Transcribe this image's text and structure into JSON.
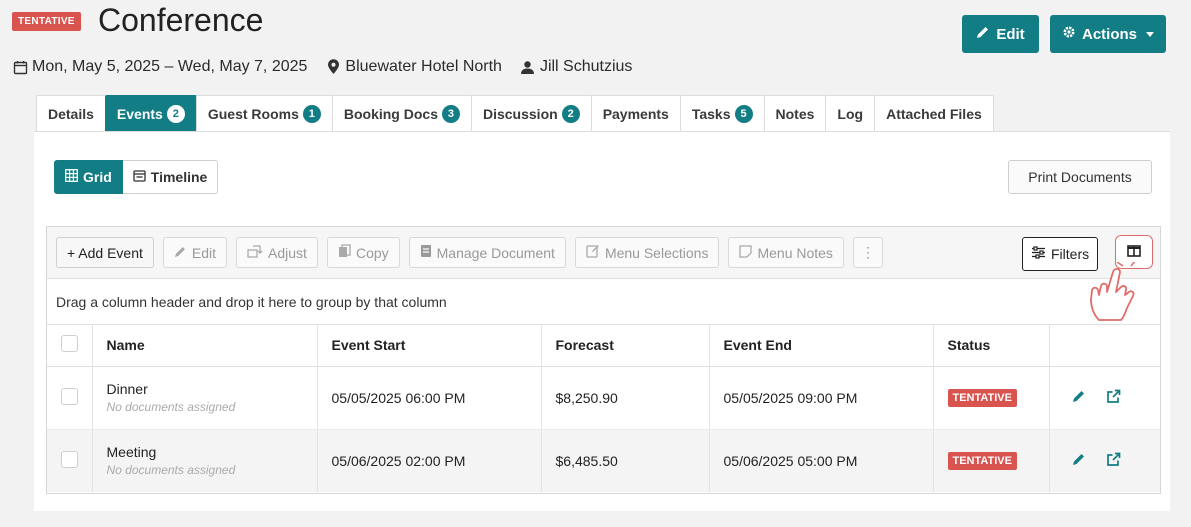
{
  "header": {
    "status_badge": "TENTATIVE",
    "title": "Conference",
    "edit_label": "Edit",
    "actions_label": "Actions",
    "date_range": "Mon, May 5, 2025 – Wed, May 7, 2025",
    "location": "Bluewater Hotel North",
    "owner": "Jill Schutzius",
    "accent_color": "#127d85",
    "tentative_color": "#d9534f"
  },
  "tabs": [
    {
      "label": "Details",
      "count": null,
      "active": false
    },
    {
      "label": "Events",
      "count": "2",
      "active": true
    },
    {
      "label": "Guest Rooms",
      "count": "1",
      "active": false
    },
    {
      "label": "Booking Docs",
      "count": "3",
      "active": false
    },
    {
      "label": "Discussion",
      "count": "2",
      "active": false
    },
    {
      "label": "Payments",
      "count": null,
      "active": false
    },
    {
      "label": "Tasks",
      "count": "5",
      "active": false
    },
    {
      "label": "Notes",
      "count": null,
      "active": false
    },
    {
      "label": "Log",
      "count": null,
      "active": false
    },
    {
      "label": "Attached Files",
      "count": null,
      "active": false
    }
  ],
  "view_toggle": {
    "grid_label": "Grid",
    "timeline_label": "Timeline",
    "selected": "Grid"
  },
  "print_label": "Print Documents",
  "toolbar": {
    "add_event": "+ Add Event",
    "edit": "Edit",
    "adjust": "Adjust",
    "copy": "Copy",
    "manage_document": "Manage Document",
    "menu_selections": "Menu Selections",
    "menu_notes": "Menu Notes",
    "more": "⋮",
    "filters": "Filters"
  },
  "group_hint": "Drag a column header and drop it here to group by that column",
  "table": {
    "columns": [
      "Name",
      "Event Start",
      "Forecast",
      "Event End",
      "Status"
    ],
    "rows": [
      {
        "name": "Dinner",
        "docs": "No documents assigned",
        "start": "05/05/2025 06:00 PM",
        "forecast": "$8,250.90",
        "end": "05/05/2025 09:00 PM",
        "status": "TENTATIVE"
      },
      {
        "name": "Meeting",
        "docs": "No documents assigned",
        "start": "05/06/2025 02:00 PM",
        "forecast": "$6,485.50",
        "end": "05/06/2025 05:00 PM",
        "status": "TENTATIVE"
      }
    ]
  }
}
